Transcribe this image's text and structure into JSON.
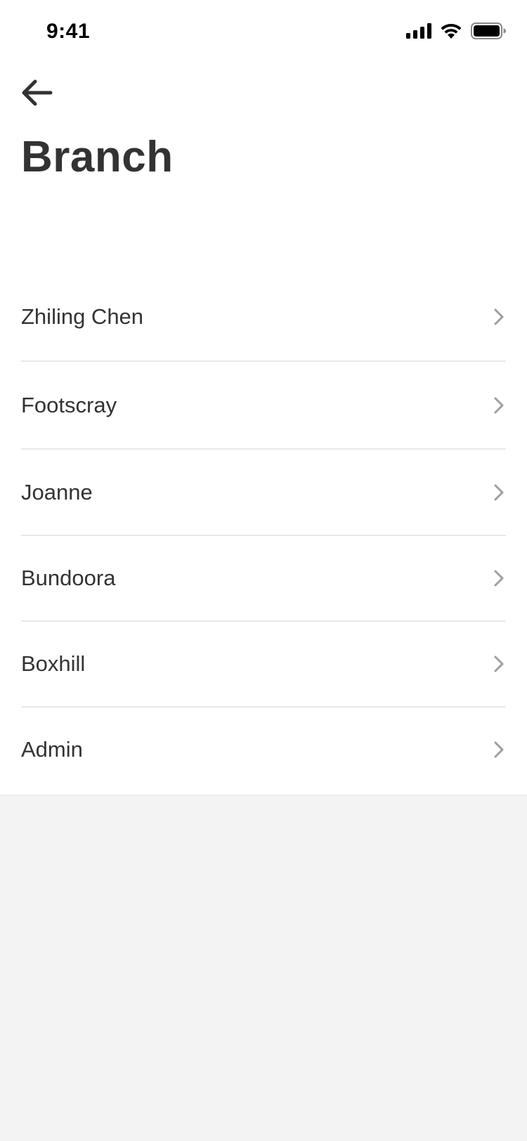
{
  "status_bar": {
    "time": "9:41",
    "icons": [
      "signal-icon",
      "wifi-icon",
      "battery-icon"
    ]
  },
  "header": {
    "back_icon": "arrow-left-icon",
    "title": "Branch"
  },
  "branches": [
    {
      "label": "Zhiling Chen"
    },
    {
      "label": "Footscray"
    },
    {
      "label": "Joanne"
    },
    {
      "label": "Bundoora"
    },
    {
      "label": "Boxhill"
    },
    {
      "label": "Admin"
    }
  ],
  "colors": {
    "text": "#333333",
    "chevron": "#9e9e9e",
    "divider": "#e8e8e8",
    "background": "#ffffff",
    "footer_background": "#f3f3f3"
  }
}
